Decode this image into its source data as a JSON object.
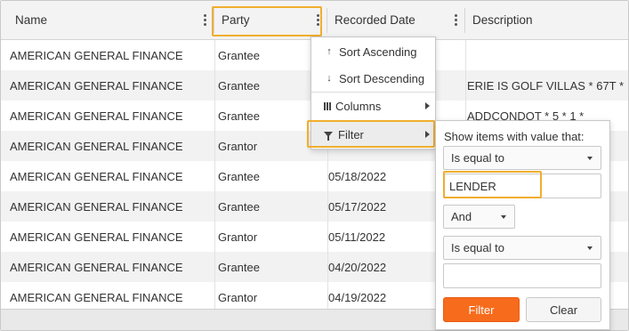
{
  "columns": {
    "name": "Name",
    "party": "Party",
    "recorded_date": "Recorded Date",
    "description": "Description"
  },
  "rows": [
    {
      "name": "AMERICAN GENERAL FINANCE",
      "party": "Grantee",
      "date": "",
      "description": ""
    },
    {
      "name": "AMERICAN GENERAL FINANCE",
      "party": "Grantee",
      "date": "",
      "description": "ERIE IS GOLF VILLAS * 67T *"
    },
    {
      "name": "AMERICAN GENERAL FINANCE",
      "party": "Grantee",
      "date": "",
      "description": "ADDCONDOT * 5 * 1 *"
    },
    {
      "name": "AMERICAN GENERAL FINANCE",
      "party": "Grantor",
      "date": "",
      "description": ""
    },
    {
      "name": "AMERICAN GENERAL FINANCE",
      "party": "Grantee",
      "date": "05/18/2022",
      "description": ""
    },
    {
      "name": "AMERICAN GENERAL FINANCE",
      "party": "Grantee",
      "date": "05/17/2022",
      "description": ""
    },
    {
      "name": "AMERICAN GENERAL FINANCE",
      "party": "Grantor",
      "date": "05/11/2022",
      "description": ""
    },
    {
      "name": "AMERICAN GENERAL FINANCE",
      "party": "Grantee",
      "date": "04/20/2022",
      "description": ""
    },
    {
      "name": "AMERICAN GENERAL FINANCE",
      "party": "Grantor",
      "date": "04/19/2022",
      "description": ""
    }
  ],
  "column_menu": {
    "sort_ascending": "Sort Ascending",
    "sort_descending": "Sort Descending",
    "columns": "Columns",
    "filter": "Filter",
    "icons": {
      "sort_ascending": "arrow-up-icon",
      "sort_descending": "arrow-down-icon",
      "columns": "columns-icon",
      "filter": "funnel-icon"
    }
  },
  "filter_panel": {
    "title": "Show items with value that:",
    "operator1": "Is equal to",
    "value1": "LENDER",
    "logic": "And",
    "operator2": "Is equal to",
    "value2": "",
    "filter_button": "Filter",
    "clear_button": "Clear"
  },
  "colors": {
    "highlight": "#f0ae2d",
    "filter_button": "#f76b1c",
    "header_bg": "#f3f3f3",
    "alt_row_bg": "#f2f2f2"
  }
}
